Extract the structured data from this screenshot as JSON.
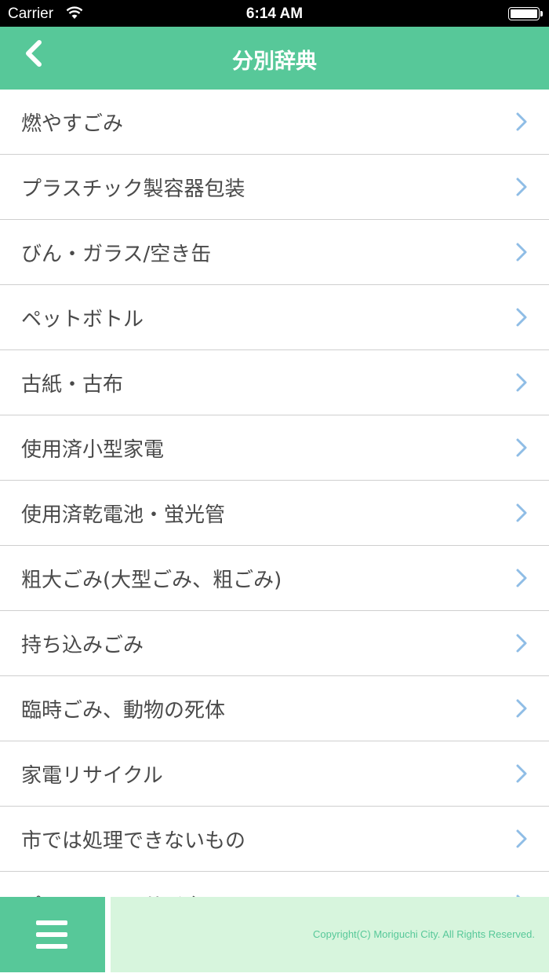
{
  "status_bar": {
    "carrier": "Carrier",
    "time": "6:14 AM"
  },
  "nav": {
    "title": "分別辞典",
    "back_icon": "chevron-left-icon"
  },
  "list": {
    "items": [
      {
        "label": "燃やすごみ"
      },
      {
        "label": "プラスチック製容器包装"
      },
      {
        "label": "びん・ガラス/空き缶"
      },
      {
        "label": "ペットボトル"
      },
      {
        "label": "古紙・古布"
      },
      {
        "label": "使用済小型家電"
      },
      {
        "label": "使用済乾電池・蛍光管"
      },
      {
        "label": "粗大ごみ(大型ごみ、粗ごみ)"
      },
      {
        "label": "持ち込みごみ"
      },
      {
        "label": "臨時ごみ、動物の死体"
      },
      {
        "label": "家電リサイクル"
      },
      {
        "label": "市では処理できないもの"
      },
      {
        "label": "パソコンのリサイクル"
      }
    ],
    "chevron_icon": "chevron-right-icon"
  },
  "footer": {
    "menu_icon": "hamburger-menu-icon",
    "copyright": "Copyright(C) Moriguchi City. All Rights Reserved."
  },
  "colors": {
    "accent_green": "#57c899",
    "footer_bg": "#d7f5dd",
    "chevron_blue": "#8fbde6",
    "text": "#4a4a4a",
    "divider": "#cfcfcf"
  }
}
